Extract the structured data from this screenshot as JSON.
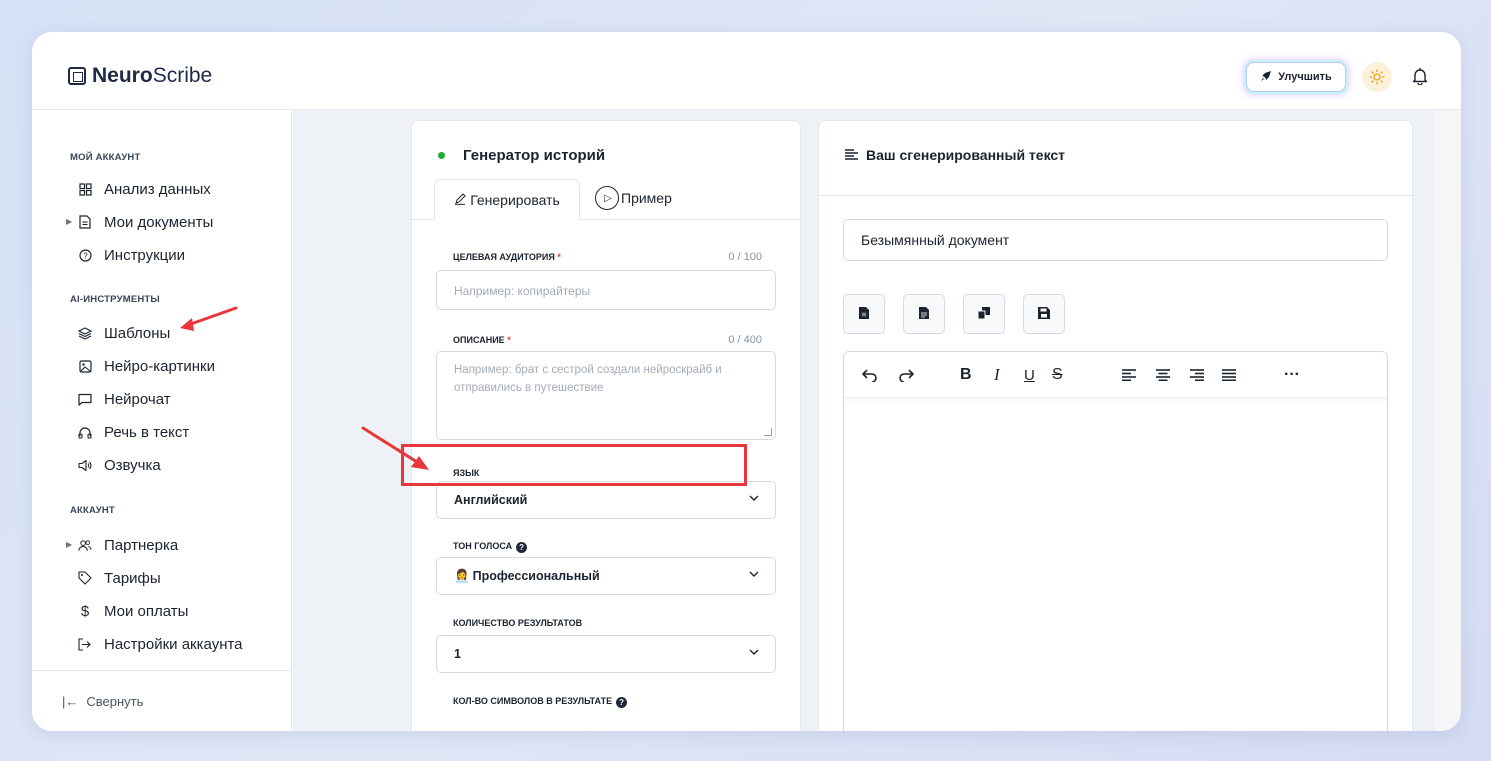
{
  "header": {
    "logo_bold": "Neuro",
    "logo_rest": "Scribe",
    "upgrade_label": "Улучшить"
  },
  "sidebar": {
    "section_my_account": "МОЙ АККАУНТ",
    "section_ai_tools": "AI-ИНСТРУМЕНТЫ",
    "section_account": "АККАУНТ",
    "items": [
      {
        "label": "Анализ данных",
        "icon": "grid-icon"
      },
      {
        "label": "Мои документы",
        "icon": "document-icon"
      },
      {
        "label": "Инструкции",
        "icon": "help-circle-icon"
      },
      {
        "label": "Шаблоны",
        "icon": "layers-icon"
      },
      {
        "label": "Нейро-картинки",
        "icon": "image-icon"
      },
      {
        "label": "Нейрочат",
        "icon": "chat-icon"
      },
      {
        "label": "Речь в текст",
        "icon": "headphones-icon"
      },
      {
        "label": "Озвучка",
        "icon": "speaker-icon"
      },
      {
        "label": "Партнерка",
        "icon": "users-icon"
      },
      {
        "label": "Тарифы",
        "icon": "tag-icon"
      },
      {
        "label": "Мои оплаты",
        "icon": "dollar-icon"
      },
      {
        "label": "Настройки аккаунта",
        "icon": "logout-icon"
      }
    ],
    "collapse_label": "Свернуть"
  },
  "generator": {
    "title": "Генератор историй",
    "tab_generate": "Генерировать",
    "tab_example": "Пример",
    "audience_label": "ЦЕЛЕВАЯ АУДИТОРИЯ",
    "audience_count": "0 / 100",
    "audience_placeholder": "Например: копирайтеры",
    "description_label": "ОПИСАНИЕ",
    "description_count": "0 / 400",
    "description_placeholder": "Например: брат с сестрой создали нейроскрайб и отправились в путешествие",
    "language_label": "ЯЗЫК",
    "language_value": "Английский",
    "tone_label": "ТОН ГОЛОСА",
    "tone_value": "Профессиональный",
    "results_label": "КОЛИЧЕСТВО РЕЗУЛЬТАТОВ",
    "results_value": "1",
    "chars_label": "КОЛ-ВО СИМВОЛОВ В РЕЗУЛЬТАТЕ"
  },
  "output": {
    "title": "Ваш сгенерированный текст",
    "document_name": "Безымянный документ"
  },
  "colors": {
    "accent_red": "#e8373a",
    "status_green": "#1fae2c",
    "required_red": "#e53a3a"
  }
}
